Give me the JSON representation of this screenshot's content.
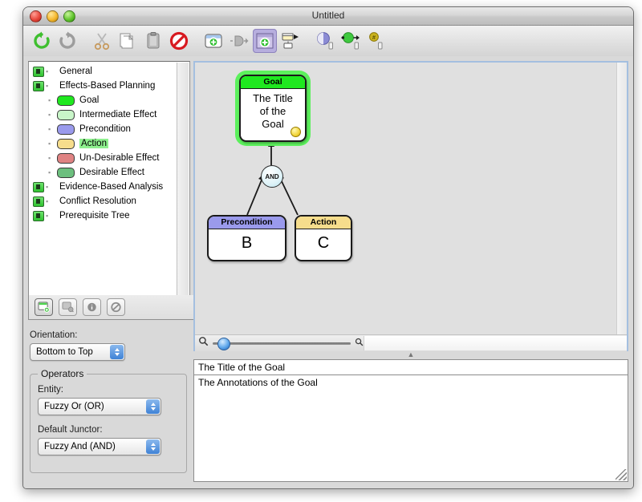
{
  "window": {
    "title": "Untitled",
    "controls": [
      {
        "name": "close",
        "color": "#e8483c"
      },
      {
        "name": "minimize",
        "color": "#f5b830"
      },
      {
        "name": "zoom",
        "color": "#62c52f"
      }
    ]
  },
  "toolbar": {
    "items": [
      {
        "name": "undo-icon",
        "label": "Undo"
      },
      {
        "name": "redo-icon",
        "label": "Redo"
      },
      {
        "name": "cut-icon",
        "label": "Cut"
      },
      {
        "name": "copy-icon",
        "label": "Copy"
      },
      {
        "name": "paste-icon",
        "label": "Paste"
      },
      {
        "name": "delete-icon",
        "label": "Delete"
      },
      {
        "name": "add-entity-icon",
        "label": "Add Entity"
      },
      {
        "name": "add-junctor-icon",
        "label": "Add Junctor"
      },
      {
        "name": "add-node-icon",
        "label": "Add Node",
        "selected": true
      },
      {
        "name": "add-annotation-icon",
        "label": "Add Annotation"
      },
      {
        "name": "evaluate-icon",
        "label": "Evaluate"
      },
      {
        "name": "propagate-icon",
        "label": "Propagate"
      },
      {
        "name": "number-icon",
        "label": "Number"
      }
    ]
  },
  "sidebar": {
    "tree": [
      {
        "type": "group",
        "label": "General",
        "indent": 0
      },
      {
        "type": "group",
        "label": "Effects-Based Planning",
        "indent": 0
      },
      {
        "type": "leaf",
        "label": "Goal",
        "indent": 1,
        "swatch": "#1fe81f",
        "selected": false
      },
      {
        "type": "leaf",
        "label": "Intermediate Effect",
        "indent": 1,
        "swatch": "#c9f6c9",
        "selected": false
      },
      {
        "type": "leaf",
        "label": "Precondition",
        "indent": 1,
        "swatch": "#9a9aec",
        "selected": false
      },
      {
        "type": "leaf",
        "label": "Action",
        "indent": 1,
        "swatch": "#f6dd8c",
        "selected": true
      },
      {
        "type": "leaf",
        "label": "Un-Desirable Effect",
        "indent": 1,
        "swatch": "#e08383",
        "selected": false
      },
      {
        "type": "leaf",
        "label": "Desirable Effect",
        "indent": 1,
        "swatch": "#6cbf7e",
        "selected": false
      },
      {
        "type": "group",
        "label": "Evidence-Based Analysis",
        "indent": 0
      },
      {
        "type": "group",
        "label": "Conflict Resolution",
        "indent": 0
      },
      {
        "type": "group",
        "label": "Prerequisite Tree",
        "indent": 0
      }
    ],
    "tree_buttons": [
      {
        "name": "new-entity-button",
        "active": true
      },
      {
        "name": "new-annotation-button",
        "active": false
      },
      {
        "name": "info-button",
        "active": false
      },
      {
        "name": "disable-button",
        "active": false
      }
    ],
    "orientation": {
      "label": "Orientation:",
      "value": "Bottom to Top"
    },
    "operators": {
      "legend": "Operators",
      "entity": {
        "label": "Entity:",
        "value": "Fuzzy Or (OR)"
      },
      "junctor": {
        "label": "Default Junctor:",
        "value": "Fuzzy And (AND)"
      }
    }
  },
  "canvas": {
    "nodes": [
      {
        "id": "goal",
        "name": "goal-node",
        "header": "Goal",
        "body": "The Title\nof the\nGoal",
        "header_color": "#1fe81f",
        "selected": true,
        "has_marker": true
      },
      {
        "id": "precondition",
        "name": "precondition-node",
        "header": "Precondition",
        "body": "B",
        "header_color": "#9a9aec",
        "selected": false,
        "has_marker": false
      },
      {
        "id": "action",
        "name": "action-node",
        "header": "Action",
        "body": "C",
        "header_color": "#f6dd8c",
        "selected": false,
        "has_marker": false
      }
    ],
    "junctor": {
      "name": "and-junctor",
      "label": "AND"
    },
    "zoom_slider": {
      "min_icon": "search-small-icon",
      "max_icon": "search-large-icon",
      "value": 4
    }
  },
  "details": {
    "title_value": "The Title of the Goal",
    "annotations_value": "The Annotations of the Goal"
  }
}
